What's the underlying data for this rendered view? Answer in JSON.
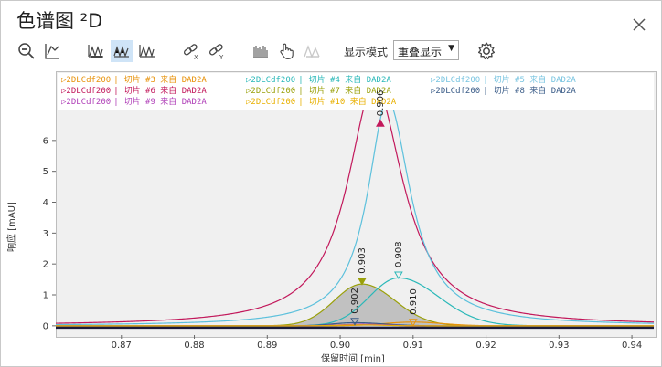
{
  "window": {
    "title": "色谱图 ²D"
  },
  "toolbar": {
    "display_mode_label": "显示模式",
    "display_mode_value": "重叠显示",
    "buttons": [
      {
        "name": "zoom-out-icon"
      },
      {
        "name": "autoscale-icon"
      },
      {
        "name": "peaks-view-1-icon"
      },
      {
        "name": "peaks-view-2-icon",
        "active": true
      },
      {
        "name": "peaks-view-3-icon"
      },
      {
        "name": "link-x-icon"
      },
      {
        "name": "link-y-icon"
      },
      {
        "name": "fraction-icon"
      },
      {
        "name": "hand-pointer-icon"
      },
      {
        "name": "peaks-disabled-icon"
      },
      {
        "name": "settings-gear-icon"
      }
    ]
  },
  "legend": [
    {
      "marker": "▷",
      "source": "2DLCdf200",
      "sep": "|",
      "slice": "切片 #3 来自 DAD2A",
      "color": "#e8920a",
      "row": 0,
      "col": 0
    },
    {
      "marker": "▷",
      "source": "2DLCdf200",
      "sep": "|",
      "slice": "切片 #4 来自 DAD2A",
      "color": "#2ab8b8",
      "row": 0,
      "col": 1
    },
    {
      "marker": "▷",
      "source": "2DLCdf200",
      "sep": "|",
      "slice": "切片 #5 来自 DAD2A",
      "color": "#78c4e0",
      "row": 0,
      "col": 2
    },
    {
      "marker": "▷",
      "source": "2DLCdf200",
      "sep": "|",
      "slice": "切片 #6 来自 DAD2A",
      "color": "#c2185b",
      "row": 1,
      "col": 0
    },
    {
      "marker": "▷",
      "source": "2DLCdf200",
      "sep": "|",
      "slice": "切片 #7 来自 DAD2A",
      "color": "#9aa00a",
      "row": 1,
      "col": 1
    },
    {
      "marker": "▷",
      "source": "2DLCdf200",
      "sep": "|",
      "slice": "切片 #8 来自 DAD2A",
      "color": "#3a5c88",
      "row": 1,
      "col": 2
    },
    {
      "marker": "▷",
      "source": "2DLCdf200",
      "sep": "|",
      "slice": "切片 #9 来自 DAD2A",
      "color": "#b040b8",
      "row": 2,
      "col": 0
    },
    {
      "marker": "▷",
      "source": "2DLCdf200",
      "sep": "|",
      "slice": "切片 #10 来自 DAD2A",
      "color": "#e8b000",
      "row": 2,
      "col": 1
    }
  ],
  "chart_data": {
    "type": "line",
    "xlabel": "保留时间 [min]",
    "ylabel": "响应 [mAU]",
    "xlim": [
      0.861,
      0.943
    ],
    "ylim": [
      -0.3,
      7.0
    ],
    "xticks": [
      0.87,
      0.88,
      0.89,
      0.9,
      0.91,
      0.92,
      0.93,
      0.94
    ],
    "xtick_labels": [
      "0.87",
      "0.88",
      "0.89",
      "0.90",
      "0.91",
      "0.92",
      "0.93",
      "0.94"
    ],
    "yticks": [
      0,
      1,
      2,
      3,
      4,
      5,
      6
    ],
    "ytick_labels": [
      "0",
      "1",
      "2",
      "3",
      "4",
      "5",
      "6"
    ],
    "series": [
      {
        "name": "切片 #6 来自 DAD2A",
        "color": "#c2185b",
        "peak_x": 0.9047,
        "peak_y": 7.8,
        "width_left": 0.0045,
        "width_right": 0.0048,
        "shape": "lorentz"
      },
      {
        "name": "切片 #5 来自 DAD2A",
        "color": "#5bc0dc",
        "peak_x": 0.9065,
        "peak_y": 7.3,
        "width_left": 0.0033,
        "width_right": 0.0038,
        "shape": "lorentz"
      },
      {
        "name": "切片 #7 来自 DAD2A",
        "color": "#9aa00a",
        "peak_x": 0.903,
        "peak_y": 1.35,
        "width_left": 0.0038,
        "width_right": 0.0045,
        "shape": "gauss",
        "filled": true
      },
      {
        "name": "切片 #4 来自 DAD2A",
        "color": "#2ab8b8",
        "peak_x": 0.908,
        "peak_y": 1.55,
        "width_left": 0.004,
        "width_right": 0.0055,
        "shape": "gauss"
      },
      {
        "name": "切片 #3 来自 DAD2A",
        "color": "#e8920a",
        "peak_x": 0.91,
        "peak_y": 0.12,
        "width_left": 0.004,
        "width_right": 0.004,
        "shape": "gauss"
      },
      {
        "name": "切片 #8 来自 DAD2A",
        "color": "#3a5c88",
        "peak_x": 0.902,
        "peak_y": 0.1,
        "width_left": 0.003,
        "width_right": 0.004,
        "shape": "gauss"
      },
      {
        "name": "切片 #9 来自 DAD2A",
        "color": "#b040b8",
        "peak_x": 0.903,
        "peak_y": 0.05,
        "width_left": 0.003,
        "width_right": 0.003,
        "shape": "gauss"
      },
      {
        "name": "切片 #10 来自 DAD2A",
        "color": "#e8b000",
        "peak_x": 0.903,
        "peak_y": 0.03,
        "width_left": 0.003,
        "width_right": 0.003,
        "shape": "gauss"
      }
    ],
    "peak_labels": [
      {
        "text": "0.906",
        "x": 0.9055,
        "y": 6.55,
        "color": "#c2185b",
        "marker": "filled-up"
      },
      {
        "text": "0.903",
        "x": 0.903,
        "y": 1.45,
        "color": "#9aa00a",
        "marker": "filled-down"
      },
      {
        "text": "0.908",
        "x": 0.908,
        "y": 1.65,
        "color": "#2ab8b8",
        "marker": "open-down"
      },
      {
        "text": "0.902",
        "x": 0.902,
        "y": 0.15,
        "color": "#3a5c88",
        "marker": "open-down"
      },
      {
        "text": "0.910",
        "x": 0.91,
        "y": 0.12,
        "color": "#e8920a",
        "marker": "open-down"
      }
    ]
  }
}
